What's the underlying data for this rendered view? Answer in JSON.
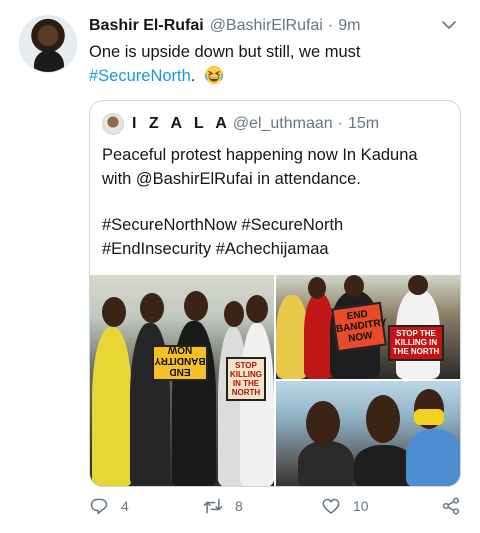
{
  "tweet": {
    "author_name": "Bashir El-Rufai",
    "author_handle": "@BashirElRufai",
    "separator": "·",
    "time": "9m",
    "text_line1": "One is upside down but still, we must",
    "hashtag": "#SecureNorth",
    "text_after_hashtag": ".",
    "emoji": "grinning-squinting-emoji"
  },
  "quoted": {
    "author_name": "I Z A L A",
    "author_handle": "@el_uthmaan",
    "separator": "·",
    "time": "15m",
    "line1": "Peaceful protest happening now In Kaduna",
    "line2": "with @BashirElRufai in attendance.",
    "line3": "#SecureNorthNow #SecureNorth",
    "line4": "#EndInsecurity #Achechijamaa",
    "photo_signs": {
      "upside_down": "END BANDITRY NOW",
      "poster_left": "STOP KILLING IN THE NORTH",
      "end_banditry": "END BANDITRY NOW",
      "stop_killing": "STOP THE KILLING IN THE NORTH"
    }
  },
  "actions": {
    "reply_count": "4",
    "retweet_count": "8",
    "like_count": "10",
    "colors": {
      "icon": "#657786",
      "link": "#1b95e0"
    }
  }
}
